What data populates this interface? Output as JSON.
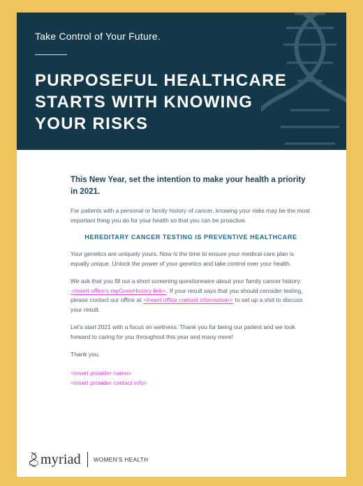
{
  "hero": {
    "tagline": "Take Control of Your Future.",
    "headline": "PURPOSEFUL HEALTHCARE\nSTARTS WITH KNOWING\nYOUR RISKS"
  },
  "content": {
    "intro": "This New Year, set the intention to make your health a priority in 2021.",
    "paragraph_1": "For patients with a personal or family history of cancer, knowing your risks may be the most important thing you do for your health so that you can be proactive.",
    "section_title": "HEREDITARY CANCER TESTING IS PREVENTIVE HEALTHCARE",
    "paragraph_2": "Your genetics are uniquely yours. Now is the time to ensure your medical care plan is equally unique. Unlock the power of your genetics and take control over your health.",
    "paragraph_3_part_1": "We ask that you fill out a short screening questionnaire about your family cancer history: ",
    "paragraph_3_placeholder_link": "<insert office's myGeneHistory link>",
    "paragraph_3_part_2": ". If your result says that you should consider testing, please contact our office at ",
    "paragraph_3_placeholder_contact": "<insert office contact information>",
    "paragraph_3_part_3": " to set up a visit to discuss your result.",
    "paragraph_4": "Let's start 2021 with a focus on wellness. Thank you for being our patient and we look forward to caring for you throughout this year and many more!",
    "thank_you": "Thank you,",
    "provider_name": "<insert provider name>",
    "provider_contact": "<insert provider contact info>"
  },
  "footer": {
    "logo": "myriad",
    "division": "WOMEN'S HEALTH"
  }
}
